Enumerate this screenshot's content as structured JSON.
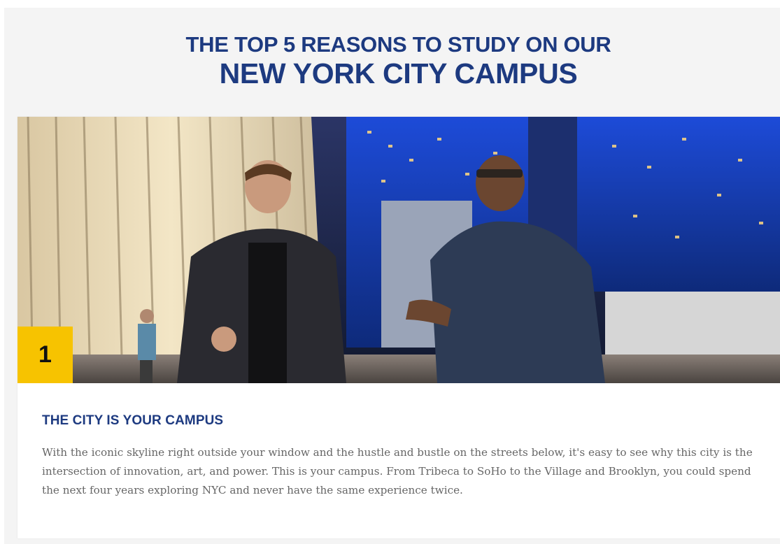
{
  "header": {
    "title_line1": "THE TOP 5 REASONS TO STUDY ON OUR",
    "title_line2": "NEW YORK CITY CAMPUS"
  },
  "reason": {
    "number": "1",
    "heading": "THE CITY IS YOUR CAMPUS",
    "body": "With the iconic skyline right outside your window and the hustle and bustle on the streets below, it's easy to see why this city is the intersection of innovation, art, and power. This is your campus. From Tribeca to SoHo to the Village and Brooklyn, you could spend the next four years exploring NYC and never have the same experience twice."
  },
  "colors": {
    "title": "#1d3a80",
    "badge": "#f7c300",
    "body_text": "#666666",
    "panel_bg": "#f4f4f4"
  }
}
